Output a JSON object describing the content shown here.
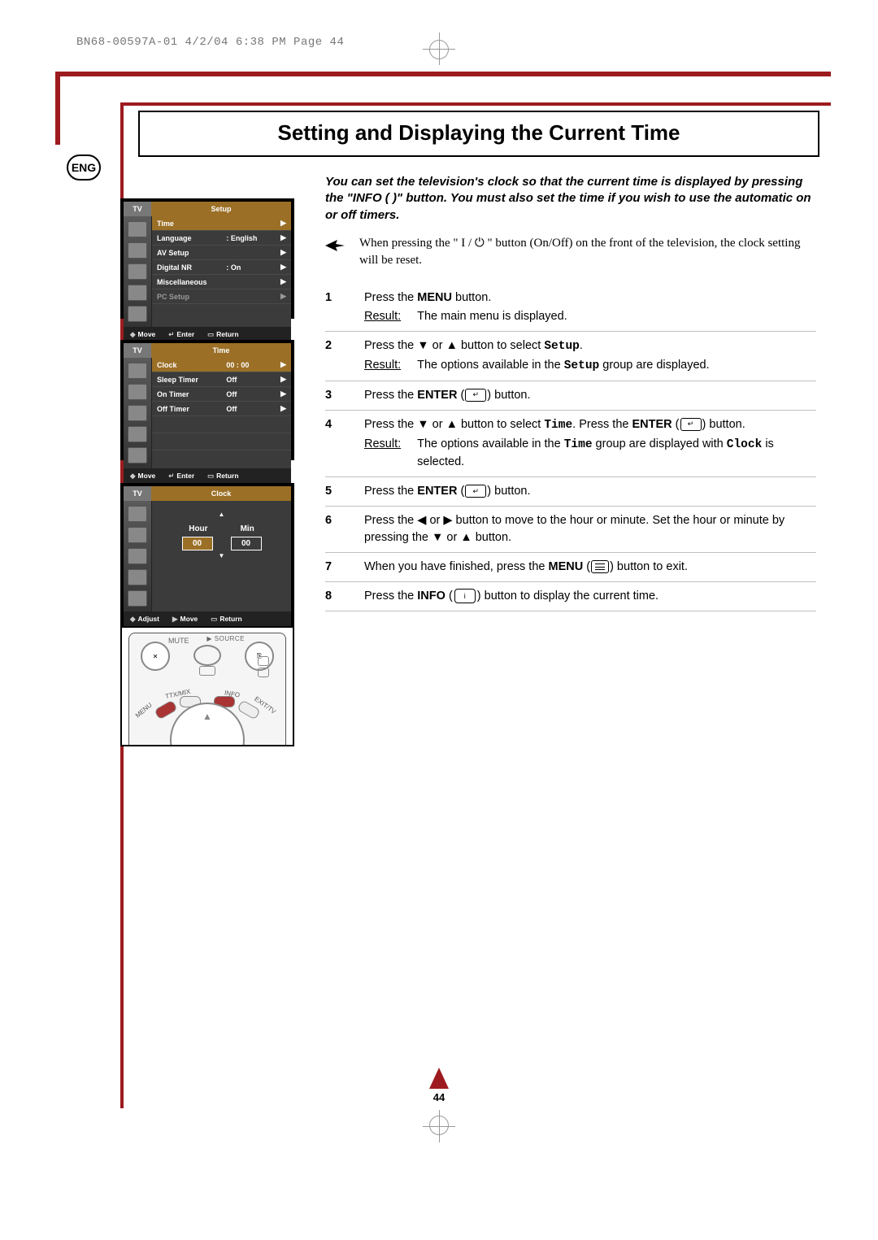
{
  "doc_header": "BN68-00597A-01  4/2/04  6:38 PM  Page 44",
  "lang_badge": "ENG",
  "title": "Setting and Displaying the Current Time",
  "intro": "You can set the television's clock so that the current time is displayed by pressing the \"INFO (    )\" button. You must also set the time if you wish to use the automatic on or off timers.",
  "note": "When pressing the \" I / ⏻ \" button (On/Off) on the front of the television, the clock setting will be reset.",
  "result_label": "Result:",
  "steps": [
    {
      "n": "1",
      "text_a": "Press the ",
      "bold1": "MENU",
      "text_b": " button.",
      "result": "The main menu is displayed."
    },
    {
      "n": "2",
      "text": "Press the ▼ or ▲ button to select ",
      "mono": "Setup",
      "text_end": ".",
      "result": "The options available in the Setup group are displayed."
    },
    {
      "n": "3",
      "text": "Press the ",
      "bold1": "ENTER",
      "icon": "↵",
      "text_end": " button."
    },
    {
      "n": "4",
      "text": "Press the ▼ or ▲ button to select ",
      "mono": "Time",
      "mid": ". Press the ",
      "bold1": "ENTER",
      "icon": "↵",
      "text_end": " button.",
      "result": "The options available in the Time group are displayed with Clock is selected."
    },
    {
      "n": "5",
      "text": "Press the ",
      "bold1": "ENTER",
      "icon": "↵",
      "text_end": " button."
    },
    {
      "n": "6",
      "text": "Press the ◀ or ▶ button to move to the hour or minute. Set the hour or minute by pressing the ▼ or ▲ button."
    },
    {
      "n": "7",
      "text": "When you have finished, press the ",
      "bold1": "MENU",
      "menu_icon": true,
      "text_end": " button to exit."
    },
    {
      "n": "8",
      "text": "Press the ",
      "bold1": "INFO",
      "info_icon": true,
      "text_end": " button to display the current time."
    }
  ],
  "osd1": {
    "tab": "TV",
    "title": "Setup",
    "rows": [
      {
        "label": "Time",
        "value": "",
        "selected": true
      },
      {
        "label": "Language",
        "value": ": English"
      },
      {
        "label": "AV Setup",
        "value": ""
      },
      {
        "label": "Digital NR",
        "value": ": On"
      },
      {
        "label": "Miscellaneous",
        "value": ""
      },
      {
        "label": "PC Setup",
        "value": "",
        "dim": true
      }
    ],
    "footer": {
      "move": "Move",
      "enter": "Enter",
      "return": "Return",
      "move_sym": "◆",
      "enter_sym": "↵",
      "return_sym": "▭"
    }
  },
  "osd2": {
    "tab": "TV",
    "title": "Time",
    "rows": [
      {
        "label": "Clock",
        "value": "00 : 00",
        "selected": true
      },
      {
        "label": "Sleep Timer",
        "value": "Off"
      },
      {
        "label": "On Timer",
        "value": "Off"
      },
      {
        "label": "Off Timer",
        "value": "Off"
      }
    ],
    "footer": {
      "move": "Move",
      "enter": "Enter",
      "return": "Return",
      "move_sym": "◆",
      "enter_sym": "↵",
      "return_sym": "▭"
    }
  },
  "osd3": {
    "tab": "TV",
    "title": "Clock",
    "hour_label": "Hour",
    "min_label": "Min",
    "hour_val": "00",
    "min_val": "00",
    "footer": {
      "adjust": "Adjust",
      "move": "Move",
      "return": "Return",
      "adjust_sym": "◆",
      "move_sym": "▶",
      "return_sym": "▭"
    }
  },
  "remote": {
    "mute": "MUTE",
    "source": "SOURCE",
    "menu": "MENU",
    "ttx": "TTX/MIX",
    "info": "INFO",
    "exit": "EXIT/TV"
  },
  "page_number": "44"
}
